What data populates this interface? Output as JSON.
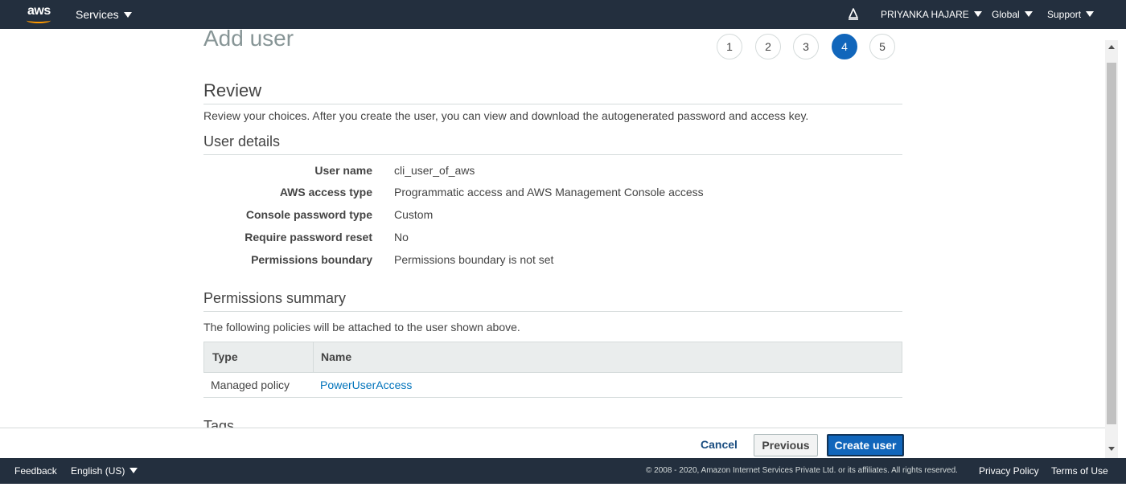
{
  "topnav": {
    "logo_text": "aws",
    "services": "Services",
    "user": "PRIYANKA HAJARE",
    "region": "Global",
    "support": "Support",
    "icons": [
      "aws-logo",
      "bell-icon"
    ]
  },
  "wizard": {
    "title": "Add user",
    "steps": [
      "1",
      "2",
      "3",
      "4",
      "5"
    ],
    "active_step": "4"
  },
  "review": {
    "title": "Review",
    "description": "Review your choices. After you create the user, you can view and download the autogenerated password and access key."
  },
  "user_details": {
    "title": "User details",
    "rows": [
      {
        "label": "User name",
        "value": "cli_user_of_aws"
      },
      {
        "label": "AWS access type",
        "value": "Programmatic access and AWS Management Console access"
      },
      {
        "label": "Console password type",
        "value": "Custom"
      },
      {
        "label": "Require password reset",
        "value": "No"
      },
      {
        "label": "Permissions boundary",
        "value": "Permissions boundary is not set"
      }
    ]
  },
  "permissions": {
    "title": "Permissions summary",
    "description": "The following policies will be attached to the user shown above.",
    "columns": [
      "Type",
      "Name"
    ],
    "rows": [
      {
        "type": "Managed policy",
        "name": "PowerUserAccess"
      }
    ]
  },
  "tags": {
    "title": "Tags"
  },
  "actions": {
    "cancel": "Cancel",
    "previous": "Previous",
    "create": "Create user"
  },
  "footer": {
    "feedback": "Feedback",
    "language": "English (US)",
    "copyright": "© 2008 - 2020, Amazon Internet Services Private Ltd. or its affiliates. All rights reserved.",
    "privacy": "Privacy Policy",
    "terms": "Terms of Use"
  },
  "colors": {
    "nav_bg": "#232f3e",
    "accent": "#1166bb",
    "link": "#0073bb",
    "aws_orange": "#ff9900"
  }
}
